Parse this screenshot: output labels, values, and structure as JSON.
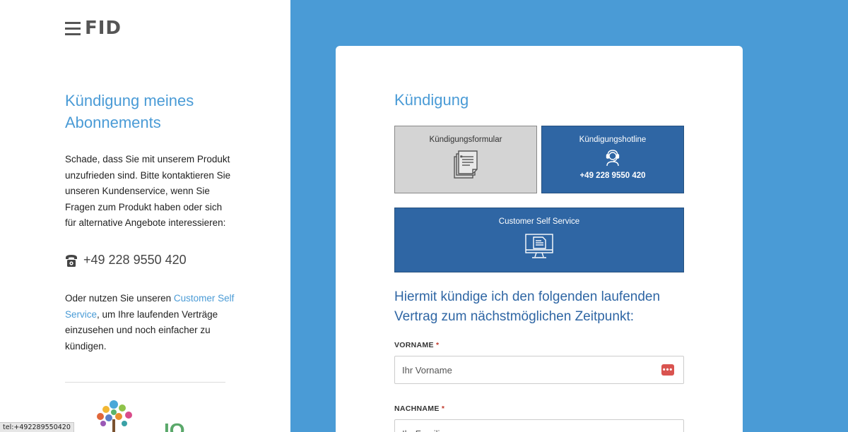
{
  "logo": {
    "text": "FID"
  },
  "left": {
    "title": "Kündigung meines Abonnements",
    "intro": "Schade, dass Sie mit unserem Produkt unzufrieden sind. Bitte kontaktieren Sie unseren Kundenservice, wenn Sie Fragen zum Produkt haben oder sich für alternative Angebote interessieren:",
    "phone": "+49 228 9550 420",
    "alt_before": "Oder nutzen Sie unseren ",
    "alt_link": "Customer Self Service",
    "alt_after": ", um Ihre laufenden Verträge einzusehen und noch einfacher zu kündigen.",
    "partner_mark": "IO"
  },
  "card": {
    "title": "Kündigung",
    "options": {
      "form": {
        "label": "Kündigungsformular",
        "icon": "documents-icon"
      },
      "hotline": {
        "label": "Kündigungshotline",
        "icon": "headset-icon",
        "phone": "+49 228 9550 420"
      },
      "self_service": {
        "label": "Customer Self Service",
        "icon": "monitor-document-icon"
      }
    },
    "form_heading": "Hiermit kündige ich den folgenden laufenden Vertrag zum nächstmöglichen Zeitpunkt:",
    "fields": {
      "firstname": {
        "label": "VORNAME",
        "required_mark": "*",
        "placeholder": "Ihr Vorname",
        "icon": "password-manager-icon",
        "icon_text": "•••"
      },
      "lastname": {
        "label": "NACHNAME",
        "required_mark": "*",
        "placeholder": "Ihr Familienname"
      }
    }
  },
  "statusbar": {
    "text": "tel:+492289550420"
  },
  "colors": {
    "accent": "#4a9bd6",
    "primary": "#2f66a4",
    "option_gray": "#d4d4d4",
    "required": "#c0392b"
  }
}
